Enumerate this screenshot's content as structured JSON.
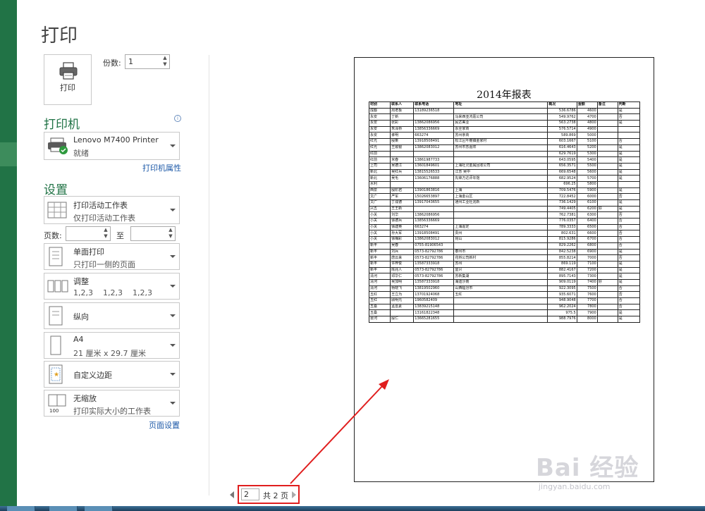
{
  "title": "打印",
  "print_button": {
    "label": "打印"
  },
  "copies": {
    "label": "份数:",
    "value": "1"
  },
  "printer_section": {
    "heading": "打印机",
    "printer_name": "Lenovo M7400 Printer",
    "status": "就绪",
    "properties_link": "打印机属性"
  },
  "settings_section": {
    "heading": "设置",
    "scope": {
      "main": "打印活动工作表",
      "sub": "仅打印活动工作表"
    },
    "pages_label": "页数:",
    "to_label": "至",
    "sides": {
      "main": "单面打印",
      "sub": "只打印一侧的页面"
    },
    "collate": {
      "main": "调整",
      "sub": "1,2,3    1,2,3    1,2,3"
    },
    "orientation": {
      "main": "纵向"
    },
    "paper": {
      "main": "A4",
      "sub": "21 厘米 x 29.7 厘米"
    },
    "margins": {
      "main": "自定义边距"
    },
    "scaling": {
      "main": "无缩放",
      "sub": "打印实际大小的工作表"
    },
    "page_setup_link": "页面设置"
  },
  "pager": {
    "current": "2",
    "total": "共 2 页"
  },
  "report": {
    "title": "2014年报表",
    "columns": [
      "材别",
      "联系人",
      "联系电话",
      "地址",
      "概况",
      "金额",
      "备注",
      "判断"
    ],
    "rows": [
      [
        "成都",
        "周老板",
        "13189236518",
        "",
        "536.6786",
        "4600",
        "",
        "是"
      ],
      [
        "永安",
        "丁新",
        "",
        "马来西亚鸿嘉公司",
        "549.9762",
        "4700",
        "",
        "否"
      ],
      [
        "永安",
        "张彩",
        "13862086956",
        "民达美业",
        "563.2738",
        "4800",
        "",
        "是"
      ],
      [
        "永安",
        "朱泽桥",
        "13856336669",
        "永全家商",
        "576.5714",
        "4900",
        "",
        ""
      ],
      [
        "永安",
        "孝明",
        "663274",
        "苏州亲商",
        "589.869",
        "5000",
        "",
        ""
      ],
      [
        "红光",
        "殷乘",
        "13918508491",
        "松江区叶榭镇金家村",
        "603.1667",
        "5100",
        "",
        "否"
      ],
      [
        "红光",
        "王顺银",
        "13862083012",
        "苏州市苏嘉阵",
        "616.4643",
        "5200",
        "",
        "是"
      ],
      [
        "红前",
        "",
        "",
        "",
        "629.7619",
        "5300",
        "",
        "是"
      ],
      [
        "红前",
        "米春",
        "13861987733",
        "",
        "643.0595",
        "5400",
        "",
        "是"
      ],
      [
        "上司",
        "吴德江",
        "13601849601",
        "上海社灵金属回收公司",
        "656.3571",
        "5500",
        "",
        "是"
      ],
      [
        "新北",
        "吴红兵",
        "13815526533",
        "江苏 吴中",
        "669.6548",
        "5600",
        "",
        "是"
      ],
      [
        "新北",
        "吴毛",
        "13606176888",
        "先锋万达评年馆",
        "682.9524",
        "5700",
        "",
        "是"
      ],
      [
        "水利",
        "",
        "",
        "",
        "696.25",
        "5800",
        "",
        ""
      ],
      [
        "西泉",
        "殷阶君",
        "13901863816",
        "上海",
        "709.5476",
        "5900",
        "",
        "是"
      ],
      [
        "文广",
        "严军",
        "15026653897",
        "上海金山区",
        "722.8452",
        "6000",
        "",
        "否"
      ],
      [
        "文广",
        "丁成德",
        "13917043655",
        "通州工业社兆新",
        "736.1429",
        "6100",
        "",
        "是"
      ],
      [
        "兴五",
        "王王新",
        "",
        "",
        "749.4405",
        "6200",
        "好",
        "是"
      ],
      [
        "小关",
        "刘华",
        "13862086956",
        "",
        "762.7381",
        "6300",
        "",
        "否"
      ],
      [
        "小关",
        "徐德兵",
        "13856336669",
        "",
        "776.0357",
        "6400",
        "",
        "否"
      ],
      [
        "小关",
        "徐建英",
        "663274",
        "上海嘉定",
        "789.3333",
        "6500",
        "",
        "否"
      ],
      [
        "小关",
        "孙大军",
        "13918508491",
        "贵州",
        "802.631",
        "6600",
        "",
        "否"
      ],
      [
        "小关",
        "徐梅彩",
        "13862083012",
        "昆山",
        "815.9286",
        "6700",
        "",
        "否"
      ],
      [
        "新丰",
        "吴春",
        "0755-81906543",
        "",
        "829.2262",
        "6800",
        "",
        "否"
      ],
      [
        "新丰",
        "刘兵",
        "0573-82792786",
        "泰州市",
        "842.5238",
        "6900",
        "",
        "是"
      ],
      [
        "新丰",
        "唐云来",
        "0573-82792786",
        "花桥公司新村",
        "855.8214",
        "7000",
        "",
        "否"
      ],
      [
        "新丰",
        "许梓俊",
        "13587333918",
        "苏州",
        "869.119",
        "7100",
        "",
        "是"
      ],
      [
        "新丰",
        "陈兆人",
        "0573-82792786",
        "宜兴",
        "882.4167",
        "7200",
        "",
        "是"
      ],
      [
        "清河",
        "邓华仁",
        "0573-82792786",
        "苏新集湖",
        "895.7143",
        "7300",
        "",
        "是"
      ],
      [
        "清河",
        "吴加明",
        "13587333918",
        "海迪沙南",
        "909.0119",
        "7400",
        "好",
        "是"
      ],
      [
        "清河",
        "杨晓飞",
        "13819502960",
        "山西临汾市",
        "922.3095",
        "7500",
        "",
        "否"
      ],
      [
        "五红",
        "王立为",
        "13701924068",
        "五红",
        "935.6071",
        "7600",
        "",
        "否"
      ],
      [
        "五红",
        "顾明元",
        "1960582409",
        "",
        "948.9048",
        "7700",
        "",
        "否"
      ],
      [
        "五桑",
        "孟蔷素",
        "13839215148",
        "",
        "962.2024",
        "7800",
        "",
        "否"
      ],
      [
        "五桑",
        "",
        "13161822348",
        "",
        "975.5",
        "7900",
        "",
        "是"
      ],
      [
        "晏河",
        "殷仁",
        "13665281655",
        "",
        "988.7976",
        "8000",
        "",
        "是"
      ]
    ]
  },
  "watermark": {
    "brand": "Bai 经验",
    "url": "jingyan.baidu.com"
  },
  "colors": {
    "accent": "#217346",
    "annotation": "#e01e1e",
    "link": "#1e5aa8"
  }
}
